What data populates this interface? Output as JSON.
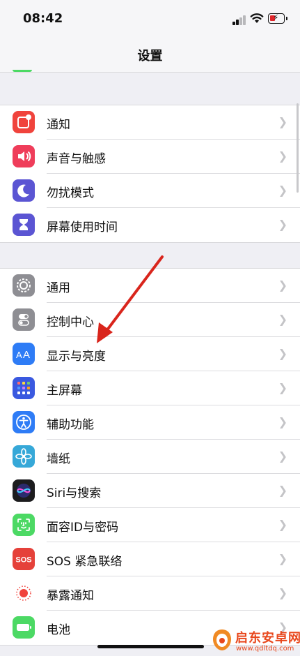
{
  "status_bar": {
    "time": "08:42"
  },
  "nav": {
    "title": "设置"
  },
  "groups": [
    {
      "rows": [
        {
          "label": "通知",
          "icon": "notifications-icon",
          "color": "#f0433c"
        },
        {
          "label": "声音与触感",
          "icon": "sound-icon",
          "color": "#ef3d5a"
        },
        {
          "label": "勿扰模式",
          "icon": "moon-icon",
          "color": "#5b55d3"
        },
        {
          "label": "屏幕使用时间",
          "icon": "hourglass-icon",
          "color": "#5b55d3"
        }
      ]
    },
    {
      "rows": [
        {
          "label": "通用",
          "icon": "gear-icon",
          "color": "#8e8e93"
        },
        {
          "label": "控制中心",
          "icon": "toggles-icon",
          "color": "#8e8e93"
        },
        {
          "label": "显示与亮度",
          "icon": "text-size-icon",
          "color": "#2e7cf6"
        },
        {
          "label": "主屏幕",
          "icon": "home-grid-icon",
          "color": "#3a59e0"
        },
        {
          "label": "辅助功能",
          "icon": "accessibility-icon",
          "color": "#2e7cf6"
        },
        {
          "label": "墙纸",
          "icon": "flower-icon",
          "color": "#36a8d8"
        },
        {
          "label": "Siri与搜索",
          "icon": "siri-icon",
          "color": "#1c1c1e"
        },
        {
          "label": "面容ID与密码",
          "icon": "face-id-icon",
          "color": "#4cd964"
        },
        {
          "label": "SOS 紧急联络",
          "icon": "sos-icon",
          "icon_text": "SOS",
          "color": "#e5413a"
        },
        {
          "label": "暴露通知",
          "icon": "exposure-icon",
          "color": "#ffffff"
        },
        {
          "label": "电池",
          "icon": "battery-icon",
          "color": "#4cd964"
        }
      ]
    }
  ],
  "watermark": {
    "name": "启东安卓网",
    "url": "www.qdltdq.com"
  }
}
